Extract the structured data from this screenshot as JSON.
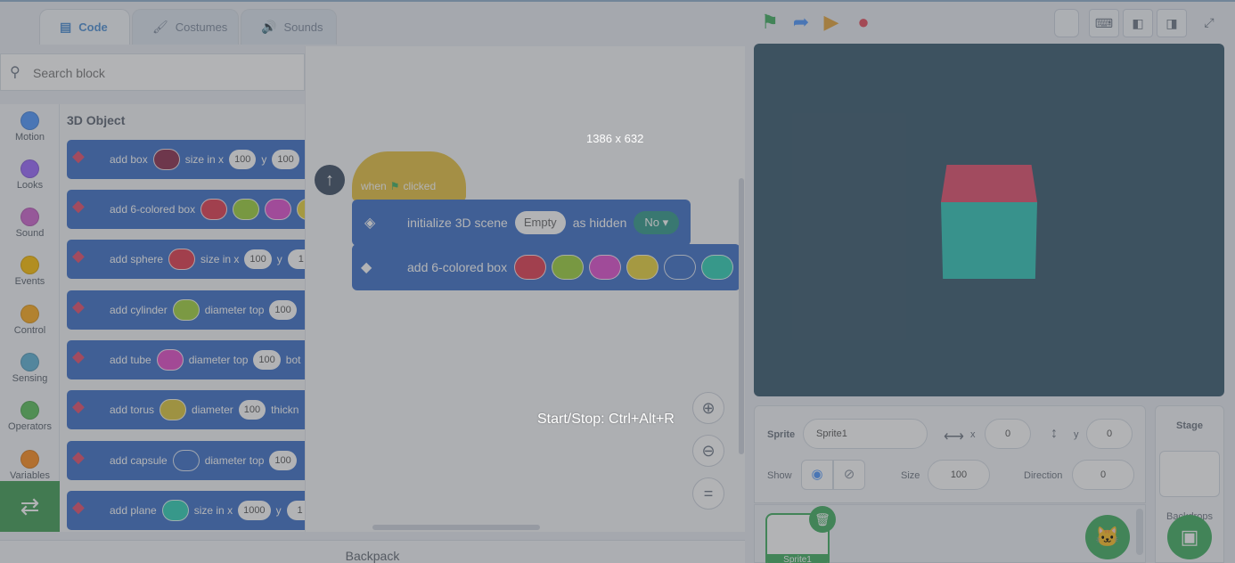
{
  "tabs": [
    {
      "label": "Code",
      "icon": "code-icon"
    },
    {
      "label": "Costumes",
      "icon": "brush-icon"
    },
    {
      "label": "Sounds",
      "icon": "speaker-icon"
    }
  ],
  "search": {
    "placeholder": "Search block"
  },
  "categories": [
    {
      "label": "Motion",
      "color": "#4c97ff"
    },
    {
      "label": "Looks",
      "color": "#9966ff"
    },
    {
      "label": "Sound",
      "color": "#cf63cf"
    },
    {
      "label": "Events",
      "color": "#ffbf00"
    },
    {
      "label": "Control",
      "color": "#ffab19"
    },
    {
      "label": "Sensing",
      "color": "#5cb1d6"
    },
    {
      "label": "Operators",
      "color": "#59c059"
    },
    {
      "label": "Variables",
      "color": "#ff8c1a"
    }
  ],
  "palette": {
    "header": "3D Object",
    "blocks": [
      {
        "text": "add box",
        "c": "#8b2a4b",
        "a": "size in x",
        "v1": "100",
        "b": "y",
        "v2": "100"
      },
      {
        "text": "add 6-colored box",
        "c": "#e23a4f",
        "c2": "#9bd13a",
        "c3": "#e14ccf",
        "c4": "#e8d23a"
      },
      {
        "text": "add sphere",
        "c": "#e2384a",
        "a": "size in x",
        "v1": "100",
        "b": "y",
        "v2": "1"
      },
      {
        "text": "add cylinder",
        "c": "#a0d23c",
        "a": "diameter top",
        "v1": "100"
      },
      {
        "text": "add tube",
        "c": "#e349c8",
        "a": "diameter top",
        "v1": "100",
        "b": "bot"
      },
      {
        "text": "add torus",
        "c": "#ddc63a",
        "a": "diameter",
        "v1": "100",
        "b": "thickn"
      },
      {
        "text": "add capsule",
        "c": "#3b6fc8",
        "a": "diameter top",
        "v1": "100"
      },
      {
        "text": "add plane",
        "c": "#2bd1b5",
        "a": "size in x",
        "v1": "1000",
        "b": "y",
        "v2": "1"
      }
    ]
  },
  "script": {
    "hat": {
      "text_a": "when",
      "text_b": "clicked",
      "flag": "green-flag-icon"
    },
    "init": {
      "label": "initialize 3D scene",
      "scene": "Empty",
      "mid": "as hidden",
      "choice": "No"
    },
    "box": {
      "label": "add 6-colored box",
      "colors": [
        "#e23a4f",
        "#9bd13a",
        "#e14ccf",
        "#e8d23a",
        "#3b6fc8",
        "#2bd1b5"
      ]
    }
  },
  "zoom": {
    "in": "+",
    "out": "−",
    "reset": "="
  },
  "backpack": "Backpack",
  "overlay": {
    "dims": "1386 x 632",
    "shortcut": "Start/Stop: Ctrl+Alt+R"
  },
  "stage": {
    "bg": "#36586d",
    "cube_top": "#e34d6b",
    "cube_front": "#2ec7b9"
  },
  "sprite_info": {
    "sprite_label": "Sprite",
    "sprite_name": "Sprite1",
    "x_label": "x",
    "x": "0",
    "y_label": "y",
    "y": "0",
    "show_label": "Show",
    "size_label": "Size",
    "size": "100",
    "direction_label": "Direction",
    "direction": "0"
  },
  "stage_panel": {
    "title": "Stage",
    "backdrops": "Backdrops"
  },
  "sprites": [
    {
      "name": "Sprite1"
    }
  ]
}
